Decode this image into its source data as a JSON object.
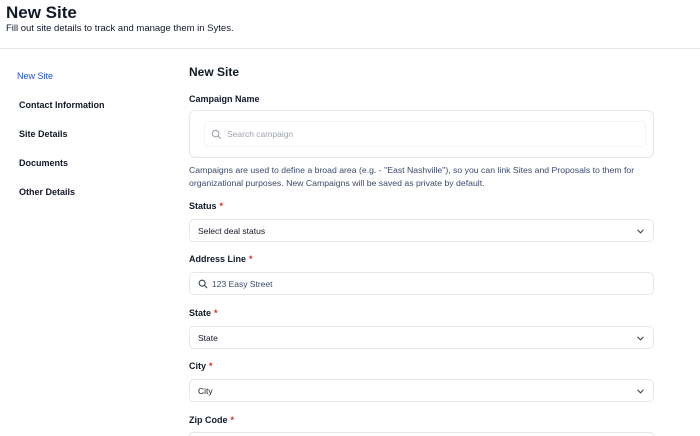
{
  "header": {
    "title": "New Site",
    "subtitle": "Fill out site details to track and manage them in Sytes."
  },
  "sidebar": {
    "items": [
      {
        "label": "New Site",
        "active": true
      },
      {
        "label": "Contact Information",
        "active": false
      },
      {
        "label": "Site Details",
        "active": false
      },
      {
        "label": "Documents",
        "active": false
      },
      {
        "label": "Other Details",
        "active": false
      }
    ]
  },
  "form": {
    "section_title": "New Site",
    "campaign": {
      "label": "Campaign Name",
      "placeholder": "Search campaign",
      "helper": "Campaigns are used to define a broad area (e.g. - \"East Nashville\"), so you can link Sites and Proposals to them for organizational purposes. New Campaigns will be saved as private by default."
    },
    "status": {
      "label": "Status",
      "required_mark": "*",
      "value": "Select deal status"
    },
    "address": {
      "label": "Address Line",
      "required_mark": "*",
      "value": "123 Easy Street"
    },
    "state": {
      "label": "State",
      "required_mark": "*",
      "value": "State"
    },
    "city": {
      "label": "City",
      "required_mark": "*",
      "value": "City"
    },
    "zip": {
      "label": "Zip Code",
      "required_mark": "*"
    }
  },
  "colors": {
    "accent": "#1d4ed8",
    "required": "#dc2626",
    "helper_text": "#3b4a6b",
    "border": "#e5e7eb"
  },
  "icons": {
    "campaign_search": "search-icon",
    "address_search": "search-icon",
    "dropdown": "chevron-down-icon"
  }
}
